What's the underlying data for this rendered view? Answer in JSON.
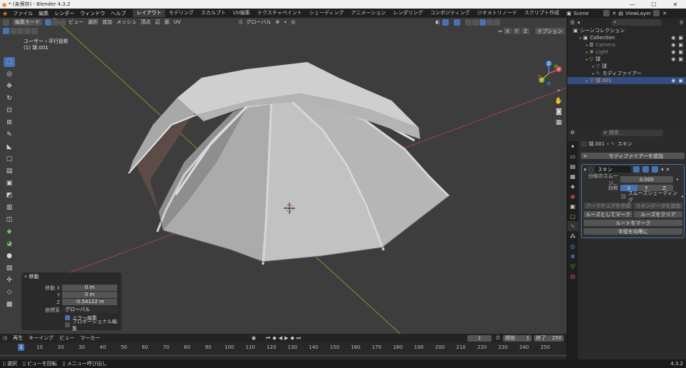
{
  "window": {
    "title": "* (未保存) - Blender 4.3.2",
    "controls": [
      "—",
      "☐",
      "✕"
    ]
  },
  "topbar": {
    "menus": [
      "ファイル",
      "編集",
      "レンダー",
      "ウィンドウ",
      "ヘルプ"
    ],
    "workspaces": [
      "レイアウト",
      "モデリング",
      "スカルプト",
      "UV編集",
      "テクスチャペイント",
      "シェーディング",
      "アニメーション",
      "レンダリング",
      "コンポジティング",
      "ジオメトリノード",
      "スクリプト作成"
    ],
    "add_tab": "+",
    "scene": "Scene",
    "view_layer": "ViewLayer"
  },
  "viewport": {
    "mode": "編集モード",
    "menus": [
      "ビュー",
      "選択",
      "追加",
      "メッシュ",
      "頂点",
      "辺",
      "面",
      "UV"
    ],
    "orientation": "グローバル",
    "options": "オプション",
    "axis_x": "X",
    "axis_y": "Y",
    "axis_z": "Z",
    "info_line1": "ユーザー・平行投影",
    "info_line2": "(1) 球.001",
    "gizmo": {
      "x": "X",
      "y": "Y",
      "z": "Z"
    }
  },
  "operator_panel": {
    "title": "移動",
    "move_x_label": "移動 X",
    "move_x": "0 m",
    "move_y_label": "Y",
    "move_y": "0 m",
    "move_z_label": "Z",
    "move_z": "-0.54122 m",
    "coord_label": "座標系",
    "coord_value": "グローバル",
    "mirror_label": "ミラー編集",
    "mirror_checked": true,
    "proportional_label": "プロポーショナル編集",
    "proportional_checked": false
  },
  "timeline": {
    "menus": [
      "再生",
      "キーイング",
      "ビュー",
      "マーカー"
    ],
    "current_frame": "1",
    "start_label": "開始",
    "start": "1",
    "end_label": "終了",
    "end": "250",
    "ticks": [
      "1",
      "10",
      "20",
      "30",
      "40",
      "50",
      "60",
      "70",
      "80",
      "90",
      "100",
      "110",
      "120",
      "130",
      "140",
      "150",
      "160",
      "170",
      "180",
      "190",
      "200",
      "210",
      "220",
      "230",
      "240",
      "250"
    ]
  },
  "statusbar": {
    "select": "選択",
    "rotate": "ビューを回転",
    "call_menu": "メニュー呼び出し",
    "version": "4.3.2"
  },
  "outliner": {
    "root": "シーンコレクション",
    "items": [
      {
        "name": "Collection",
        "depth": 1,
        "selected": false,
        "dim": false
      },
      {
        "name": "Camera",
        "depth": 2,
        "selected": false,
        "dim": true
      },
      {
        "name": "Light",
        "depth": 2,
        "selected": false,
        "dim": true
      },
      {
        "name": "球",
        "depth": 2,
        "selected": false,
        "dim": false
      },
      {
        "name": "球",
        "depth": 3,
        "selected": false,
        "dim": false
      },
      {
        "name": "モディファイアー",
        "depth": 3,
        "selected": false,
        "dim": false
      },
      {
        "name": "球.001",
        "depth": 2,
        "selected": true,
        "dim": false
      }
    ]
  },
  "properties": {
    "search_placeholder": "検索",
    "object_name": "球.001",
    "modifier_breadcrumb": "スキン",
    "add_modifier": "モディファイアーを追加",
    "modifier": {
      "name": "スキン",
      "branch_smoothing_label": "分岐のスムージ...",
      "branch_smoothing": "0.000",
      "symmetry_label": "対称",
      "sym_x": "X",
      "sym_y": "Y",
      "sym_z": "Z",
      "smooth_shading_label": "スムーズシェーディング",
      "create_armature": "アーマチュアを作成",
      "add_skin_data": "スキンデータを追加",
      "mark_loose": "ルーズとしてマーク",
      "clear_loose": "ルーズをクリア",
      "mark_root": "ルートをマーク",
      "equalize_radii": "半径を均等に"
    }
  },
  "colors": {
    "accent": "#4772b3",
    "x_axis": "#e8495b",
    "y_axis": "#88b82b",
    "z_axis": "#4a8ee2",
    "selection": "#334d80"
  }
}
